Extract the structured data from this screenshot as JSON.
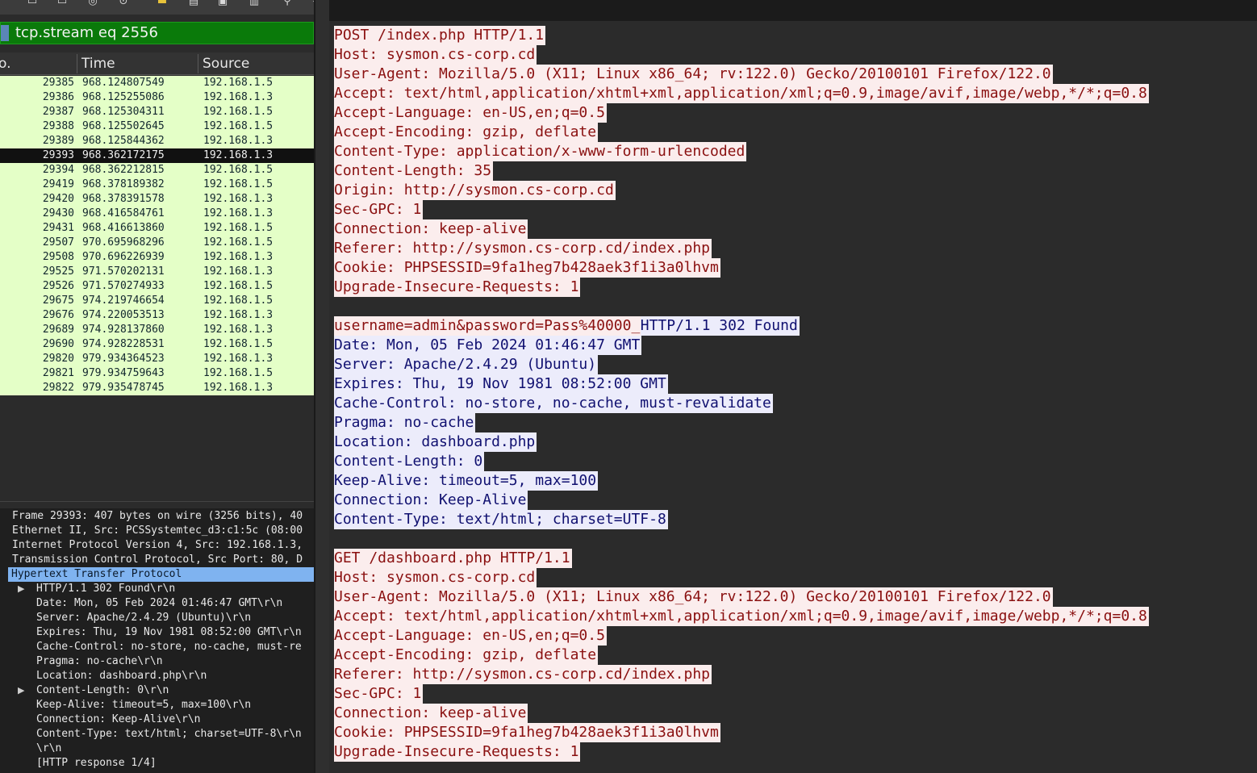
{
  "toolbar": {
    "icons": [
      "save-icon",
      "close-file-icon",
      "reload-icon",
      "options-icon",
      "folder-icon",
      "list-icon",
      "export-icon",
      "document-icon",
      "search-icon",
      "back-icon"
    ],
    "glyphs": [
      "▭",
      "▭",
      "◎",
      "⊙",
      "▬",
      "▤",
      "▣",
      "▥",
      "⚲",
      "◂"
    ]
  },
  "filter": {
    "text": "tcp.stream eq 2556",
    "bar_color": "#0a7a0a"
  },
  "packet_list": {
    "columns": [
      "o.",
      "Time",
      "Source"
    ],
    "selected_index": 5,
    "rows": [
      {
        "no": "29385",
        "time": "968.124807549",
        "source": "192.168.1.5"
      },
      {
        "no": "29386",
        "time": "968.125255086",
        "source": "192.168.1.3"
      },
      {
        "no": "29387",
        "time": "968.125304311",
        "source": "192.168.1.5"
      },
      {
        "no": "29388",
        "time": "968.125502645",
        "source": "192.168.1.5"
      },
      {
        "no": "29389",
        "time": "968.125844362",
        "source": "192.168.1.3"
      },
      {
        "no": "29393",
        "time": "968.362172175",
        "source": "192.168.1.3"
      },
      {
        "no": "29394",
        "time": "968.362212815",
        "source": "192.168.1.5"
      },
      {
        "no": "29419",
        "time": "968.378189382",
        "source": "192.168.1.5"
      },
      {
        "no": "29420",
        "time": "968.378391578",
        "source": "192.168.1.3"
      },
      {
        "no": "29430",
        "time": "968.416584761",
        "source": "192.168.1.3"
      },
      {
        "no": "29431",
        "time": "968.416613860",
        "source": "192.168.1.5"
      },
      {
        "no": "29507",
        "time": "970.695968296",
        "source": "192.168.1.5"
      },
      {
        "no": "29508",
        "time": "970.696226939",
        "source": "192.168.1.3"
      },
      {
        "no": "29525",
        "time": "971.570202131",
        "source": "192.168.1.3"
      },
      {
        "no": "29526",
        "time": "971.570274933",
        "source": "192.168.1.5"
      },
      {
        "no": "29675",
        "time": "974.219746654",
        "source": "192.168.1.5"
      },
      {
        "no": "29676",
        "time": "974.220053513",
        "source": "192.168.1.3"
      },
      {
        "no": "29689",
        "time": "974.928137860",
        "source": "192.168.1.3"
      },
      {
        "no": "29690",
        "time": "974.928228531",
        "source": "192.168.1.5"
      },
      {
        "no": "29820",
        "time": "979.934364523",
        "source": "192.168.1.3"
      },
      {
        "no": "29821",
        "time": "979.934759643",
        "source": "192.168.1.5"
      },
      {
        "no": "29822",
        "time": "979.935478745",
        "source": "192.168.1.3"
      }
    ]
  },
  "details": {
    "rows": [
      {
        "text": "Frame 29393: 407 bytes on wire (3256 bits), 40",
        "indent": 0,
        "arrow": false,
        "selected": false
      },
      {
        "text": "Ethernet II, Src: PCSSystemtec_d3:c1:5c (08:00",
        "indent": 0,
        "arrow": false,
        "selected": false
      },
      {
        "text": "Internet Protocol Version 4, Src: 192.168.1.3,",
        "indent": 0,
        "arrow": false,
        "selected": false
      },
      {
        "text": "Transmission Control Protocol, Src Port: 80, D",
        "indent": 0,
        "arrow": false,
        "selected": false
      },
      {
        "text": "Hypertext Transfer Protocol",
        "indent": 0,
        "arrow": false,
        "selected": true
      },
      {
        "text": "HTTP/1.1 302 Found\\r\\n",
        "indent": 1,
        "arrow": true,
        "selected": false
      },
      {
        "text": "Date: Mon, 05 Feb 2024 01:46:47 GMT\\r\\n",
        "indent": 1,
        "arrow": false,
        "selected": false
      },
      {
        "text": "Server: Apache/2.4.29 (Ubuntu)\\r\\n",
        "indent": 1,
        "arrow": false,
        "selected": false
      },
      {
        "text": "Expires: Thu, 19 Nov 1981 08:52:00 GMT\\r\\n",
        "indent": 1,
        "arrow": false,
        "selected": false
      },
      {
        "text": "Cache-Control: no-store, no-cache, must-re",
        "indent": 1,
        "arrow": false,
        "selected": false
      },
      {
        "text": "Pragma: no-cache\\r\\n",
        "indent": 1,
        "arrow": false,
        "selected": false
      },
      {
        "text": "Location: dashboard.php\\r\\n",
        "indent": 1,
        "arrow": false,
        "selected": false
      },
      {
        "text": "Content-Length: 0\\r\\n",
        "indent": 1,
        "arrow": true,
        "selected": false
      },
      {
        "text": "Keep-Alive: timeout=5, max=100\\r\\n",
        "indent": 1,
        "arrow": false,
        "selected": false
      },
      {
        "text": "Connection: Keep-Alive\\r\\n",
        "indent": 1,
        "arrow": false,
        "selected": false
      },
      {
        "text": "Content-Type: text/html; charset=UTF-8\\r\\n",
        "indent": 1,
        "arrow": false,
        "selected": false
      },
      {
        "text": "\\r\\n",
        "indent": 1,
        "arrow": false,
        "selected": false
      },
      {
        "text": "[HTTP response 1/4]",
        "indent": 1,
        "arrow": false,
        "selected": false
      }
    ]
  },
  "stream": {
    "client_color": "#8a1010",
    "server_color": "#101070",
    "lines": [
      {
        "text": "POST /index.php HTTP/1.1",
        "dir": "cli"
      },
      {
        "text": "Host: sysmon.cs-corp.cd",
        "dir": "cli"
      },
      {
        "text": "User-Agent: Mozilla/5.0 (X11; Linux x86_64; rv:122.0) Gecko/20100101 Firefox/122.0",
        "dir": "cli"
      },
      {
        "text": "Accept: text/html,application/xhtml+xml,application/xml;q=0.9,image/avif,image/webp,*/*;q=0.8",
        "dir": "cli"
      },
      {
        "text": "Accept-Language: en-US,en;q=0.5",
        "dir": "cli"
      },
      {
        "text": "Accept-Encoding: gzip, deflate",
        "dir": "cli"
      },
      {
        "text": "Content-Type: application/x-www-form-urlencoded",
        "dir": "cli"
      },
      {
        "text": "Content-Length: 35",
        "dir": "cli"
      },
      {
        "text": "Origin: http://sysmon.cs-corp.cd",
        "dir": "cli"
      },
      {
        "text": "Sec-GPC: 1",
        "dir": "cli"
      },
      {
        "text": "Connection: keep-alive",
        "dir": "cli"
      },
      {
        "text": "Referer: http://sysmon.cs-corp.cd/index.php",
        "dir": "cli"
      },
      {
        "text": "Cookie: PHPSESSID=9fa1heg7b428aek3f1i3a0lhvm",
        "dir": "cli"
      },
      {
        "text": "Upgrade-Insecure-Requests: 1",
        "dir": "cli"
      },
      {
        "text": "",
        "dir": "none"
      },
      {
        "text": "username=admin&password=Pass%40000_",
        "dir": "cli",
        "cont": "HTTP/1.1 302 Found"
      },
      {
        "text": "Date: Mon, 05 Feb 2024 01:46:47 GMT",
        "dir": "srv"
      },
      {
        "text": "Server: Apache/2.4.29 (Ubuntu)",
        "dir": "srv"
      },
      {
        "text": "Expires: Thu, 19 Nov 1981 08:52:00 GMT",
        "dir": "srv"
      },
      {
        "text": "Cache-Control: no-store, no-cache, must-revalidate",
        "dir": "srv"
      },
      {
        "text": "Pragma: no-cache",
        "dir": "srv"
      },
      {
        "text": "Location: dashboard.php",
        "dir": "srv"
      },
      {
        "text": "Content-Length: 0",
        "dir": "srv"
      },
      {
        "text": "Keep-Alive: timeout=5, max=100",
        "dir": "srv"
      },
      {
        "text": "Connection: Keep-Alive",
        "dir": "srv"
      },
      {
        "text": "Content-Type: text/html; charset=UTF-8",
        "dir": "srv"
      },
      {
        "text": "",
        "dir": "none"
      },
      {
        "text": "GET /dashboard.php HTTP/1.1",
        "dir": "cli"
      },
      {
        "text": "Host: sysmon.cs-corp.cd",
        "dir": "cli"
      },
      {
        "text": "User-Agent: Mozilla/5.0 (X11; Linux x86_64; rv:122.0) Gecko/20100101 Firefox/122.0",
        "dir": "cli"
      },
      {
        "text": "Accept: text/html,application/xhtml+xml,application/xml;q=0.9,image/avif,image/webp,*/*;q=0.8",
        "dir": "cli"
      },
      {
        "text": "Accept-Language: en-US,en;q=0.5",
        "dir": "cli"
      },
      {
        "text": "Accept-Encoding: gzip, deflate",
        "dir": "cli"
      },
      {
        "text": "Referer: http://sysmon.cs-corp.cd/index.php",
        "dir": "cli"
      },
      {
        "text": "Sec-GPC: 1",
        "dir": "cli"
      },
      {
        "text": "Connection: keep-alive",
        "dir": "cli"
      },
      {
        "text": "Cookie: PHPSESSID=9fa1heg7b428aek3f1i3a0lhvm",
        "dir": "cli"
      },
      {
        "text": "Upgrade-Insecure-Requests: 1",
        "dir": "cli"
      }
    ]
  }
}
